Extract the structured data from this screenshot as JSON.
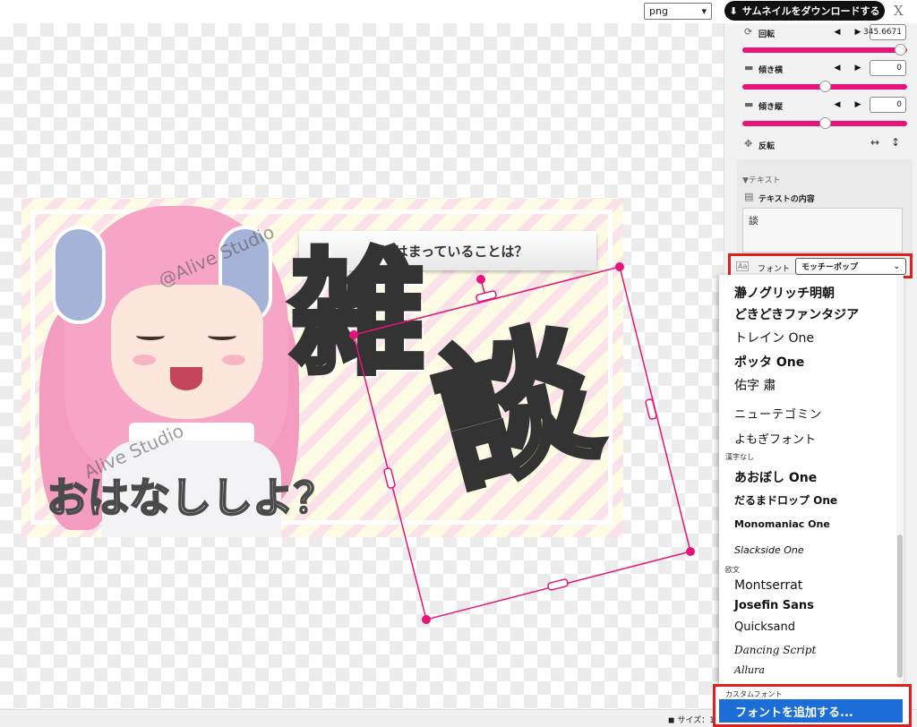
{
  "topbar": {
    "format_value": "png",
    "download_label": "サムネイルをダウンロードする",
    "x_label": "X"
  },
  "thumbnail": {
    "banner_text": "最近はまっていることは？",
    "title_char_1": "雑",
    "title_char_2": "談",
    "subtitle": "おはなししよ？",
    "watermark_1": "@Alive Studio",
    "watermark_2": "Alive Studio"
  },
  "panel": {
    "rotation_label": "回転",
    "rotation_value": "345.6671",
    "rotation_level": 0.96,
    "skew_x_label": "傾き横",
    "skew_x_value": "0",
    "skew_x_level": 0.5,
    "skew_y_label": "傾き縦",
    "skew_y_value": "0",
    "skew_y_level": 0.5,
    "flip_label": "反転",
    "text_section_title": "▼テキスト",
    "text_content_label": "テキストの内容",
    "text_content_value": "談",
    "font_icon_text": "Aa",
    "font_label": "フォント",
    "font_selected": "モッチーポップ"
  },
  "font_dropdown": {
    "group_kanji_none": "漢字なし",
    "group_latin": "欧文",
    "group_custom": "カスタムフォント",
    "options_top": [
      "瀞ノグリッチ明朝",
      "どきどきファンタジア",
      "トレイン One",
      "ポッタ One",
      "佑字 肅",
      "ニューテゴミン",
      "よもぎフォント"
    ],
    "options_kana": [
      "あおぼし One",
      "だるまドロップ One",
      "Monomaniac One",
      "Slackside One"
    ],
    "options_latin": [
      "Montserrat",
      "Josefin Sans",
      "Quicksand",
      "Dancing Script",
      "Allura"
    ],
    "add_font_label": "フォントを追加する..."
  },
  "bottombar": {
    "size_label": "サイズ：1"
  },
  "colors": {
    "accent": "#e8137a",
    "highlight_border": "#e0201f",
    "selected_option": "#1c6ed6"
  }
}
